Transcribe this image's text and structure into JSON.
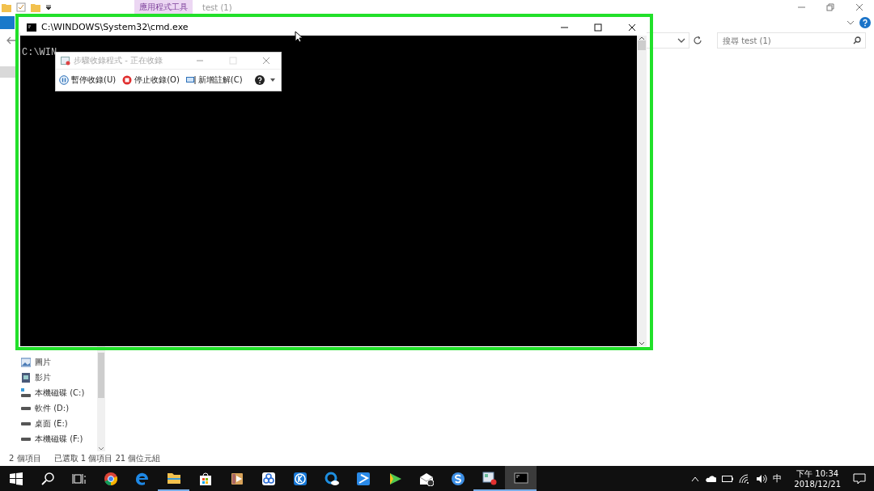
{
  "explorer": {
    "ribbon_context_tab": "應用程式工具",
    "title": "test (1)",
    "search": {
      "placeholder": "搜尋 test (1)"
    },
    "nav_items": [
      {
        "label": "圖片",
        "kind": "pictures"
      },
      {
        "label": "影片",
        "kind": "videos"
      },
      {
        "label": "本機磁碟 (C:)",
        "kind": "systemdrive"
      },
      {
        "label": "軟件 (D:)",
        "kind": "drive"
      },
      {
        "label": "桌面 (E:)",
        "kind": "drive"
      },
      {
        "label": "本機磁碟 (F:)",
        "kind": "drive"
      }
    ],
    "status_bar": {
      "item_count": "2 個項目",
      "selection": "已選取 1 個項目",
      "size": "21 個位元組"
    }
  },
  "console": {
    "title": "C:\\WINDOWS\\System32\\cmd.exe",
    "text": "C:\\WIN"
  },
  "recorder": {
    "title": "步驟收錄程式 - 正在收錄",
    "active": false,
    "buttons": [
      {
        "label": "暫停收錄(U)",
        "kind": "pause"
      },
      {
        "label": "停止收錄(O)",
        "kind": "stop"
      },
      {
        "label": "新增註解(C)",
        "kind": "comment"
      }
    ]
  },
  "taskbar": {
    "apps": [
      {
        "kind": "chrome",
        "running": false,
        "selected": false
      },
      {
        "kind": "edge",
        "running": false,
        "selected": false
      },
      {
        "kind": "folder",
        "running": true,
        "selected": false
      },
      {
        "kind": "store",
        "running": false,
        "selected": false
      },
      {
        "kind": "player",
        "running": false,
        "selected": false
      },
      {
        "kind": "cloud",
        "running": false,
        "selected": false
      },
      {
        "kind": "k",
        "running": false,
        "selected": false
      },
      {
        "kind": "qcloud",
        "running": false,
        "selected": false
      },
      {
        "kind": "arrow",
        "running": false,
        "selected": false
      },
      {
        "kind": "play",
        "running": false,
        "selected": false
      },
      {
        "kind": "mail",
        "running": false,
        "selected": false
      },
      {
        "kind": "s",
        "running": false,
        "selected": false
      },
      {
        "kind": "recorder",
        "running": true,
        "selected": false
      },
      {
        "kind": "console",
        "running": true,
        "selected": true
      }
    ],
    "ime": "中",
    "clock": {
      "time": "下午 10:34",
      "date": "2018/12/21"
    }
  }
}
